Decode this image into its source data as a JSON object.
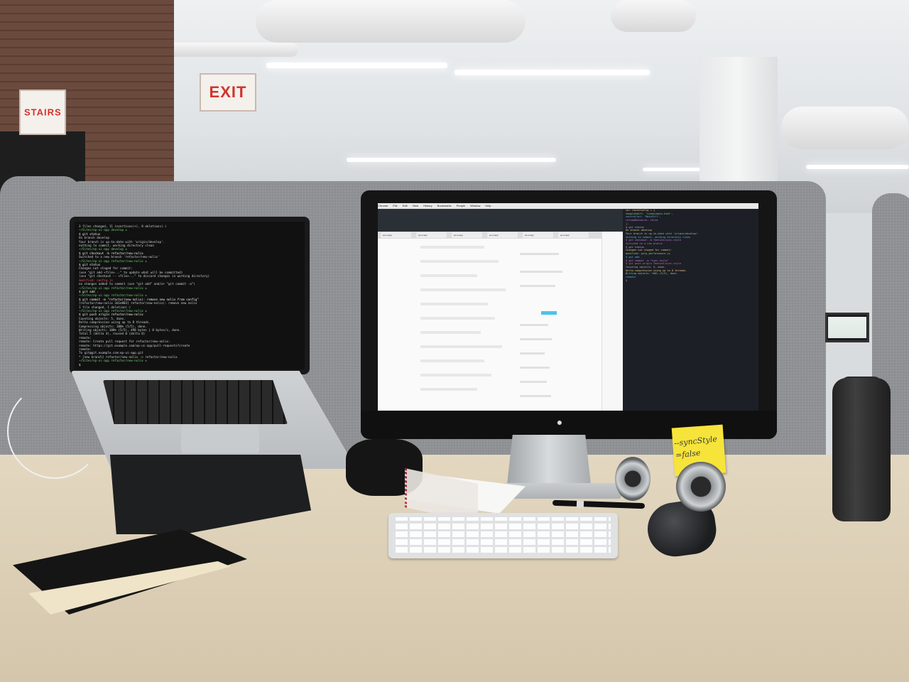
{
  "scene": {
    "signs": {
      "exit": "EXIT",
      "stairs": "STAIRS"
    },
    "sticky_note": {
      "line1": "--syncStyle",
      "line2": "=false"
    }
  },
  "laptop": {
    "terminal_lines": [
      "3 files changed, 11 insertions(+), 0 deletions(-)",
      "~/Sites/ep-ui-app  develop ±",
      "$ git status",
      "On branch develop",
      "Your branch is up-to-date with 'origin/develop'.",
      "nothing to commit, working directory clean",
      "~/Sites/ep-ui-app  develop ±",
      "$ git checkout -b refactor/new-nolix",
      "Switched to a new branch 'refactor/new-nolix'",
      "~/Sites/ep-ui-app  refactor/new-nolix ±",
      "$ git status",
      "Changes not staged for commit:",
      "  (use \"git add <file>...\" to update what will be committed)",
      "  (use \"git checkout -- <file>...\" to discard changes in working directory)",
      "        modified:   config.js",
      "",
      "no changes added to commit (use \"git add\" and/or \"git commit -a\")",
      "~/Sites/ep-ui-app  refactor/new-nolix ±",
      "$ git add .",
      "~/Sites/ep-ui-app  refactor/new-nolix ±",
      "$ git commit -m \"refactor(new-nolix): remove new nolix from config\"",
      "[refactor/new-nolix 3d1e803] refactor(new-nolix): remove new nolix",
      " 1 file changed, 1 deletion(-)",
      "~/Sites/ep-ui-app  refactor/new-nolix ±",
      "$ git push origin refactor/new-nolix",
      "Counting objects: 5, done.",
      "Delta compression using up to 8 threads.",
      "Compressing objects: 100% (5/5), done.",
      "Writing objects: 100% (5/5), 498 bytes | 0 bytes/s, done.",
      "Total 5 (delta 4), reused 0 (delta 0)",
      "remote:",
      "remote: Create pull request for refactor/new-nolix:",
      "remote:   https://git.example.com/ep-ui-app/pull-requests?create",
      "remote:",
      "To git@git.example.com:ep-ui-app.git",
      " * [new branch]      refactor/new-nolix -> refactor/new-nolix",
      "~/Sites/ep-ui-app  refactor/new-nolix ±",
      "$"
    ]
  },
  "monitor": {
    "menubar": [
      "Chrome",
      "File",
      "Edit",
      "View",
      "History",
      "Bookmarks",
      "People",
      "Window",
      "Help"
    ],
    "tabs": [
      "ep-ui-app",
      "ep-ui-app",
      "ep-ui-app",
      "ep-ui-app",
      "ep-ui-app",
      "ep-ui-app"
    ],
    "code_lines": [
      "  var routeConfig = {",
      "    templateUrl: 'views/main.html',",
      "    controller: 'MainCtrl',",
      "    reloadOnSearch: false",
      "  };",
      "$ git status",
      "On branch develop",
      "Your branch is up-to-date with 'origin/develop'.",
      "nothing to commit, working directory clean",
      "$ git checkout -b feature/sync-style",
      "Switched to a new branch",
      "$ git status",
      "Changes not staged for commit:",
      "  modified: gulp_performance.js",
      "$ git add .",
      "$ git commit -m \"sync style\"",
      "$ git push origin feature/sync-style",
      "Counting objects: 5, done.",
      "Delta compression using up to 8 threads.",
      "Writing objects: 100% (5/5), done.",
      "remote:",
      "$"
    ]
  },
  "colors": {
    "sticky": "#f7e43a",
    "exit_red": "#d2332b",
    "desk": "#dccfb6",
    "partition": "#8d8f92"
  }
}
